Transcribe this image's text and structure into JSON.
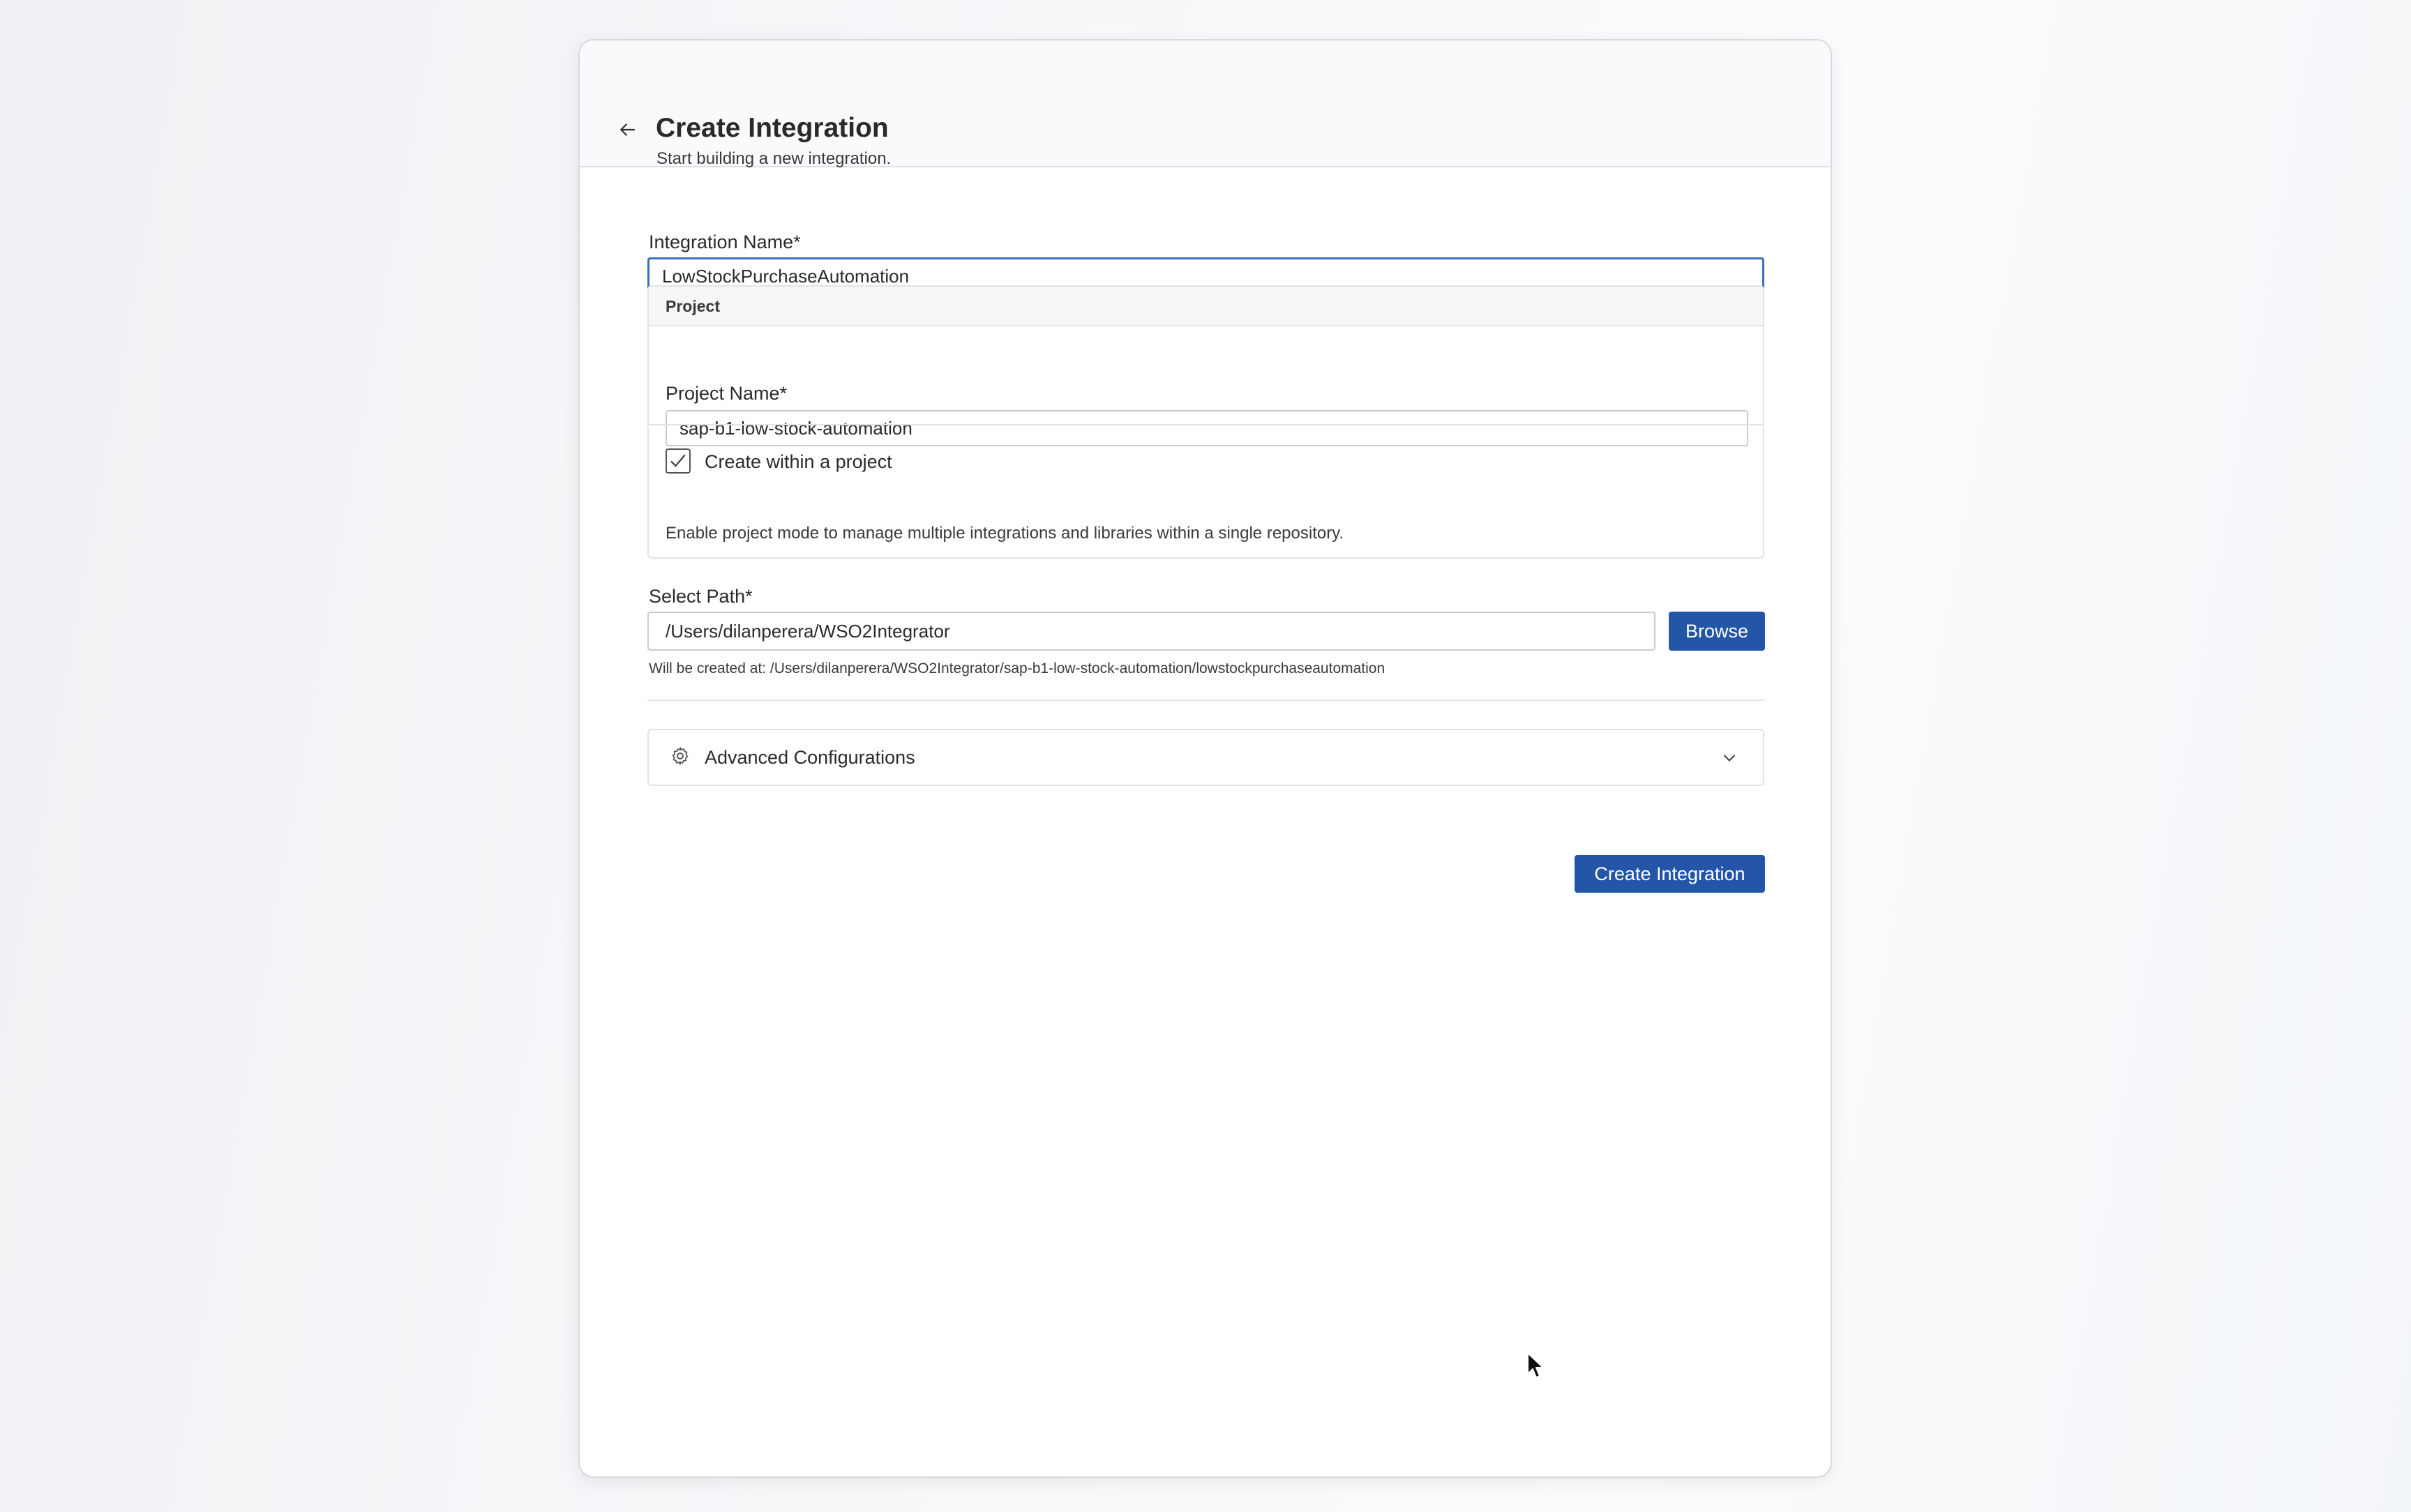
{
  "header": {
    "title": "Create Integration",
    "subtitle": "Start building a new integration.",
    "back_icon": "arrow-left-icon"
  },
  "integration_name": {
    "label": "Integration Name*",
    "value": "LowStockPurchaseAutomation"
  },
  "project": {
    "section_title": "Project",
    "name_label": "Project Name*",
    "name_value": "sap-b1-low-stock-automation",
    "create_within_label": "Create within a project",
    "create_within_checked": true,
    "description": "Enable project mode to manage multiple integrations and libraries within a single repository."
  },
  "path": {
    "label": "Select Path*",
    "value": "/Users/dilanperera/WSO2Integrator",
    "browse_label": "Browse",
    "created_at_text": "Will be created at: /Users/dilanperera/WSO2Integrator/sap-b1-low-stock-automation/lowstockpurchaseautomation"
  },
  "advanced": {
    "label": "Advanced Configurations",
    "icon": "gear-icon",
    "expand_icon": "chevron-down-icon"
  },
  "footer": {
    "create_label": "Create Integration"
  },
  "colors": {
    "primary_button": "#2456a8",
    "focus_border": "#3d6eb8"
  }
}
